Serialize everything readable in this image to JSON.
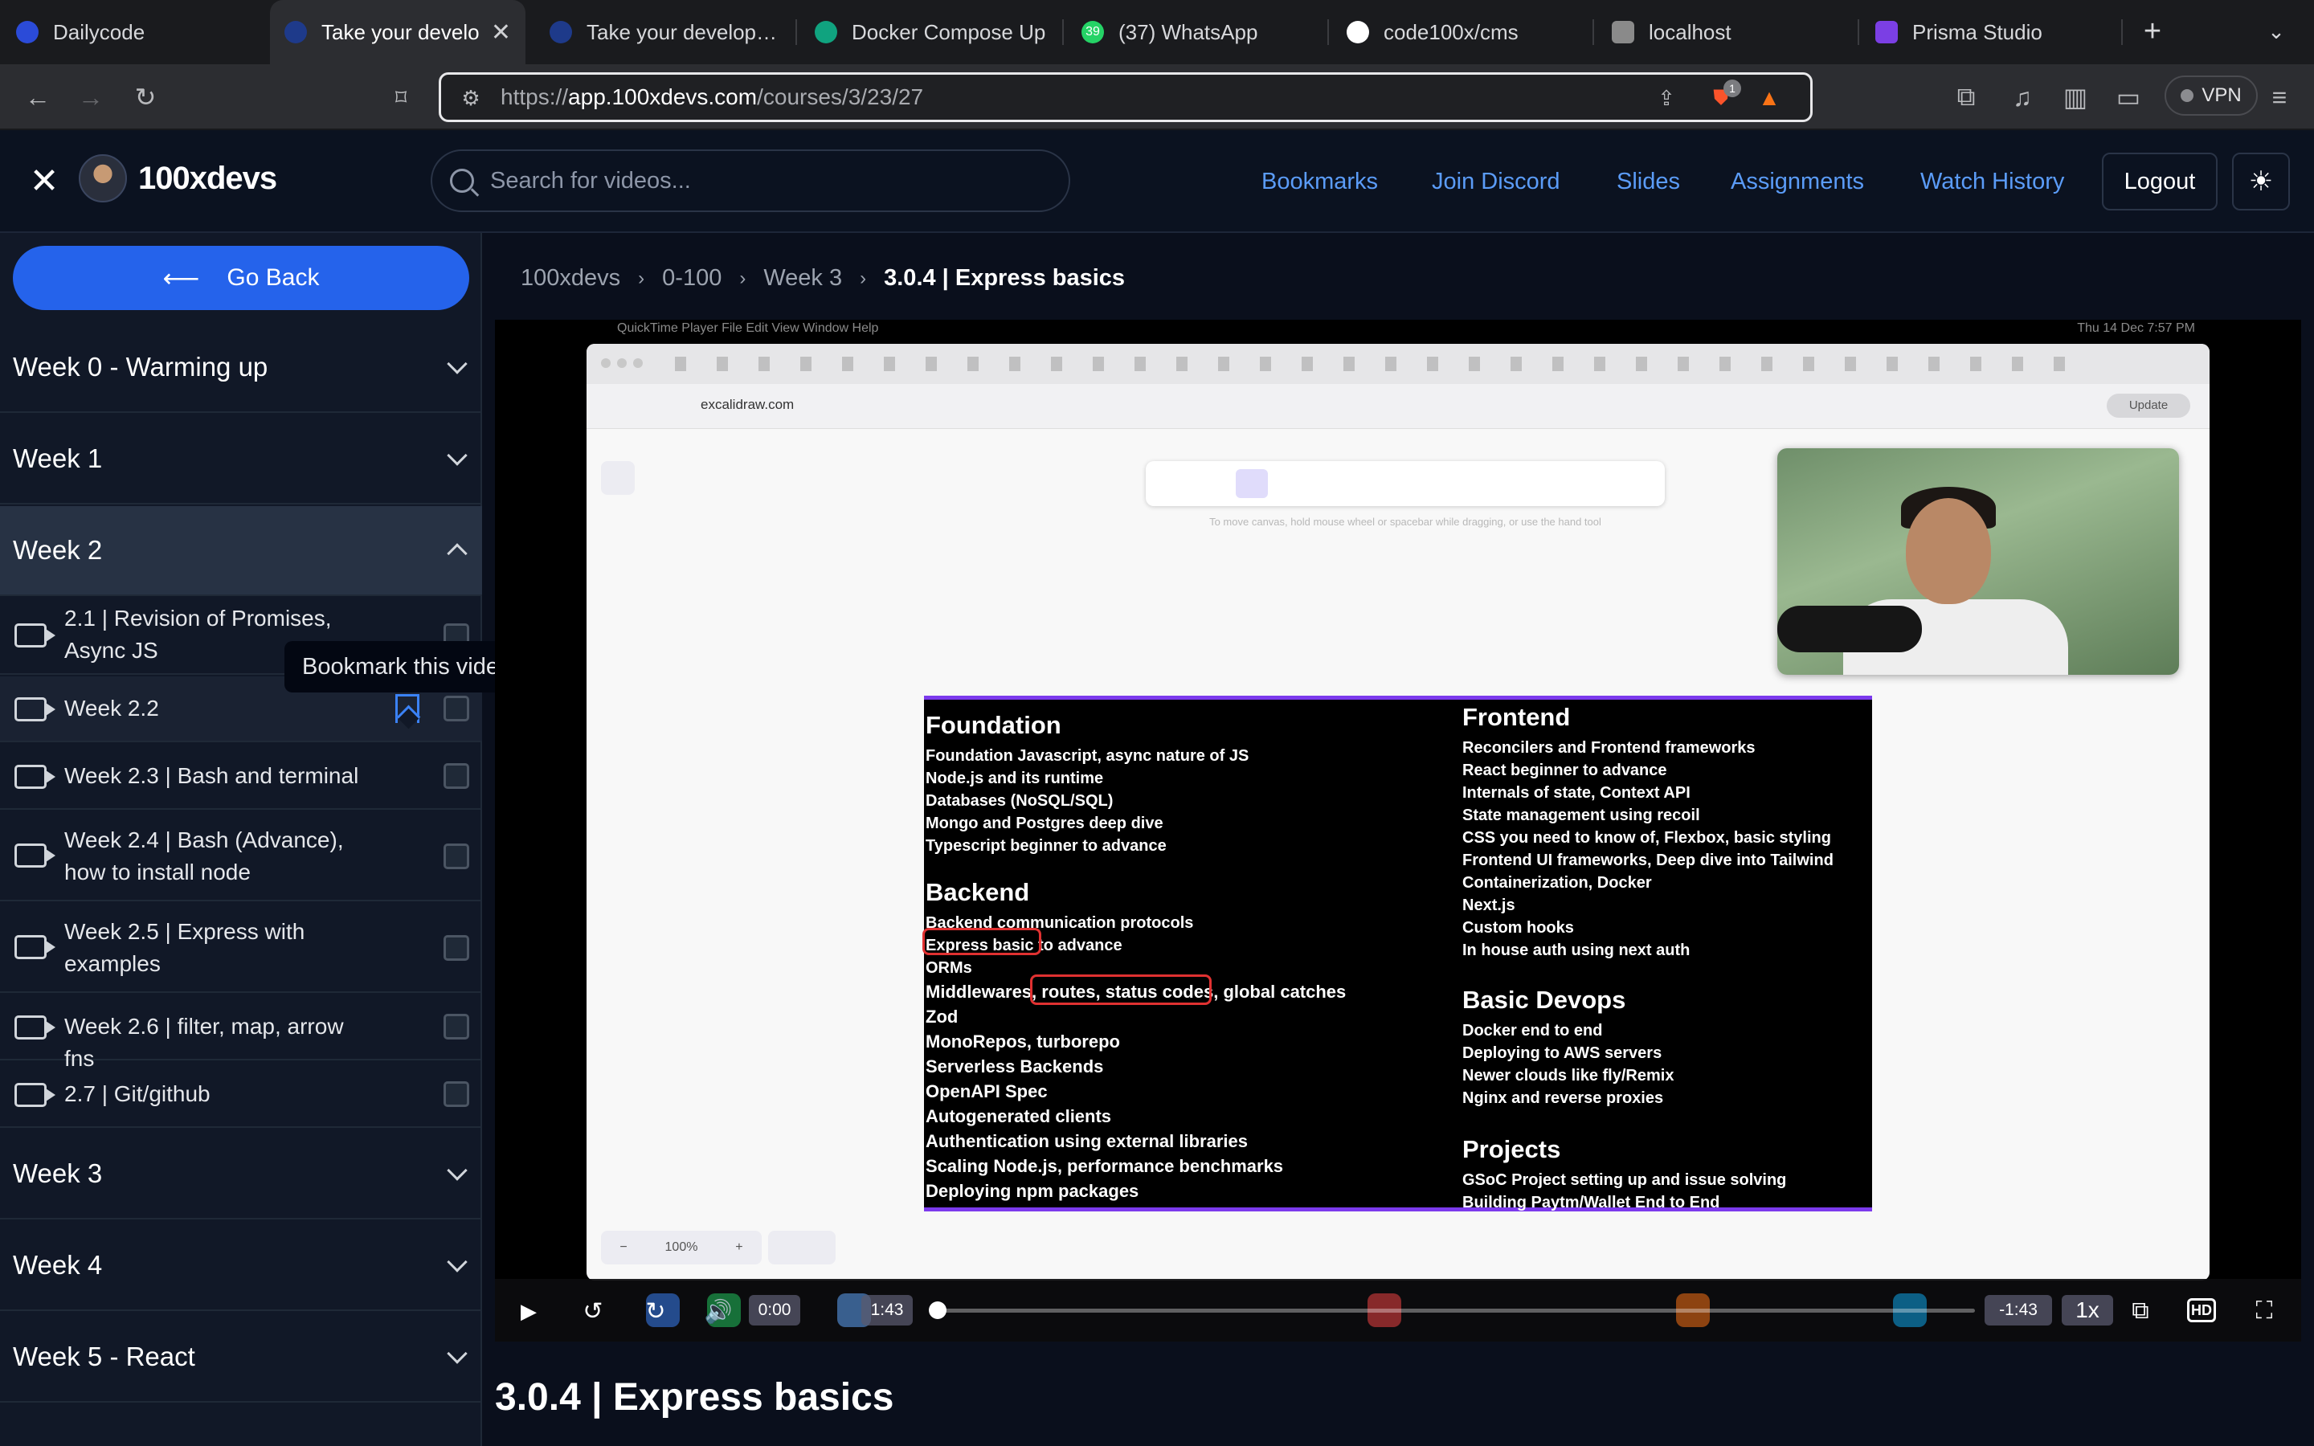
{
  "browser": {
    "tabs": [
      {
        "title": "Dailycode",
        "color": "#2b4bd8"
      },
      {
        "title": "Take your develo",
        "color": "#1e3a8a",
        "active": true
      },
      {
        "title": "Take your developme",
        "color": "#1e3a8a"
      },
      {
        "title": "Docker Compose Up",
        "color": "#10a37f"
      },
      {
        "title": "(37) WhatsApp",
        "color": "#25d366",
        "badge": "39"
      },
      {
        "title": "code100x/cms",
        "color": "#ffffff"
      },
      {
        "title": "localhost",
        "color": "#8a8a8a"
      },
      {
        "title": "Prisma Studio",
        "color": "#7b3fe4"
      }
    ],
    "url_prefix": "https://",
    "url_host": "app.100xdevs.com",
    "url_path": "/courses/3/23/27",
    "brave_badge": "1",
    "vpn_label": "VPN"
  },
  "header": {
    "brand": "100xdevs",
    "search_placeholder": "Search for videos...",
    "nav": [
      "Bookmarks",
      "Join Discord",
      "Slides",
      "Assignments",
      "Watch History"
    ],
    "logout": "Logout"
  },
  "sidebar": {
    "go_back": "Go Back",
    "weeks_top": [
      "Week 0 - Warming up",
      "Week 1",
      "Week 2"
    ],
    "lessons": [
      "2.1 | Revision of Promises, Async JS",
      "Week 2.2",
      "Week 2.3 | Bash and terminal",
      "Week 2.4 | Bash (Advance), how to install node",
      "Week 2.5 | Express with examples",
      "Week 2.6 | filter, map, arrow fns",
      "2.7 | Git/github"
    ],
    "weeks_bottom": [
      "Week 3",
      "Week 4",
      "Week 5 - React"
    ],
    "tooltip": "Bookmark this video"
  },
  "breadcrumb": [
    "100xdevs",
    "0-100",
    "Week 3",
    "3.0.4 | Express basics"
  ],
  "video": {
    "recording": {
      "menubar": "QuickTime Player   File   Edit   View   Window   Help",
      "clock": "Thu 14 Dec  7:57 PM",
      "inner_url": "excalidraw.com",
      "update_label": "Update",
      "hint": "To move canvas, hold mouse wheel or spacebar while dragging, or use the hand tool",
      "zoom": "100%"
    },
    "slide": {
      "foundation": {
        "title": "Foundation",
        "items": [
          "Foundation Javascript, async nature of JS",
          "Node.js and its runtime",
          "Databases (NoSQL/SQL)",
          "Mongo and Postgres deep dive",
          "Typescript beginner to advance"
        ]
      },
      "backend": {
        "title": "Backend",
        "items": [
          "Backend communication protocols",
          "Express basic to advance",
          "ORMs",
          "Middlewares, routes, status codes, global catches",
          "Zod",
          "MonoRepos, turborepo",
          "Serverless Backends",
          "OpenAPI Spec",
          "Autogenerated clients",
          "Authentication using external libraries",
          "Scaling Node.js, performance benchmarks",
          "Deploying npm packages"
        ]
      },
      "frontend": {
        "title": "Frontend",
        "items": [
          "Reconcilers and Frontend frameworks",
          "React beginner to advance",
          "Internals of state, Context API",
          "State management using recoil",
          "CSS you need to know of, Flexbox, basic styling",
          "Frontend UI frameworks, Deep dive into Tailwind",
          "Containerization, Docker",
          "Next.js",
          "Custom hooks",
          "In house auth using next auth"
        ]
      },
      "devops": {
        "title": "Basic Devops",
        "items": [
          "Docker end to end",
          "Deploying to AWS servers",
          "Newer clouds like fly/Remix",
          "Nginx and reverse proxies"
        ]
      },
      "projects": {
        "title": "Projects",
        "items": [
          "GSoC Project setting up and issue solving",
          "Building Paytm/Wallet End to End"
        ]
      }
    },
    "controls": {
      "current_time": "0:00",
      "duration": "1:43",
      "remaining": "-1:43",
      "speed": "1x",
      "quality": "HD",
      "progress": 0
    }
  },
  "title": "3.0.4 | Express basics"
}
